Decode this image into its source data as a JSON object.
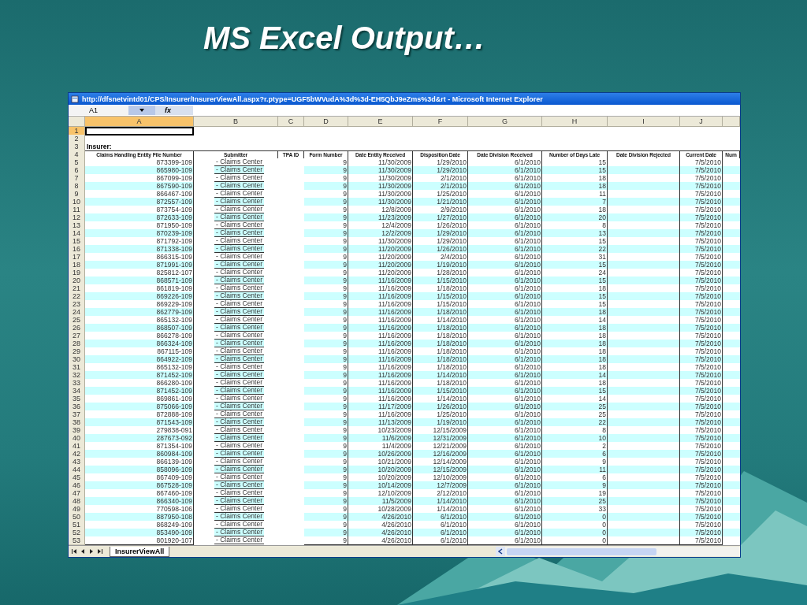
{
  "slide_title": "MS Excel Output…",
  "window": {
    "title": "http://dfsnetvintd01/CPS/Insurer/InsurerViewAll.aspx?r.ptype=UGF5bWVudA%3d%3d-EH5QbJ9eZms%3d&rt - Microsoft Internet Explorer"
  },
  "sheet": {
    "name_box": "A1",
    "function_label": "fx",
    "columns": [
      {
        "label": "A",
        "selected": true
      },
      {
        "label": "B",
        "selected": false
      },
      {
        "label": "C",
        "selected": false
      },
      {
        "label": "D",
        "selected": false
      },
      {
        "label": "E",
        "selected": false
      },
      {
        "label": "F",
        "selected": false
      },
      {
        "label": "G",
        "selected": false
      },
      {
        "label": "H",
        "selected": false
      },
      {
        "label": "I",
        "selected": false
      },
      {
        "label": "J",
        "selected": false
      }
    ],
    "rows": [
      {
        "number": "1",
        "selected": true,
        "kind": "blank"
      },
      {
        "number": "2",
        "selected": false,
        "kind": "blank"
      },
      {
        "number": "3",
        "selected": false,
        "kind": "title",
        "text": "Insurer:"
      },
      {
        "number": "4",
        "selected": false,
        "kind": "header",
        "cells": {
          "a": "Claims Handling Entity File Number",
          "b": "Submitter",
          "c": "TPA ID",
          "d": "Form Number",
          "e": "Date Entity Received",
          "f": "Disposition Date",
          "g": "Date Division Received",
          "h": "Number of Days Late",
          "i": "Date Division Rejected",
          "j": "Current Date",
          "k": "Num"
        }
      },
      {
        "number": "5",
        "selected": false,
        "kind": "data",
        "cells": {
          "a": "873399-109",
          "b": "- Claims Center",
          "d": "9",
          "e": "11/30/2009",
          "f": "1/29/2010",
          "g": "6/1/2010",
          "h": "15",
          "j": "7/5/2010"
        }
      },
      {
        "number": "6",
        "selected": false,
        "kind": "data",
        "cells": {
          "a": "865980-109",
          "b": "- Claims Center",
          "d": "9",
          "e": "11/30/2009",
          "f": "1/29/2010",
          "g": "6/1/2010",
          "h": "15",
          "j": "7/5/2010"
        }
      },
      {
        "number": "7",
        "selected": false,
        "kind": "data",
        "cells": {
          "a": "867099-109",
          "b": "- Claims Center",
          "d": "9",
          "e": "11/30/2009",
          "f": "2/1/2010",
          "g": "6/1/2010",
          "h": "18",
          "j": "7/5/2010"
        }
      },
      {
        "number": "8",
        "selected": false,
        "kind": "data",
        "cells": {
          "a": "867590-109",
          "b": "- Claims Center",
          "d": "9",
          "e": "11/30/2009",
          "f": "2/1/2010",
          "g": "6/1/2010",
          "h": "18",
          "j": "7/5/2010"
        }
      },
      {
        "number": "9",
        "selected": false,
        "kind": "data",
        "cells": {
          "a": "866467-109",
          "b": "- Claims Center",
          "d": "9",
          "e": "11/30/2009",
          "f": "1/25/2010",
          "g": "6/1/2010",
          "h": "11",
          "j": "7/5/2010"
        }
      },
      {
        "number": "10",
        "selected": false,
        "kind": "data",
        "cells": {
          "a": "872557-109",
          "b": "- Claims Center",
          "d": "9",
          "e": "11/30/2009",
          "f": "1/21/2010",
          "g": "6/1/2010",
          "h": "7",
          "j": "7/5/2010"
        }
      },
      {
        "number": "11",
        "selected": false,
        "kind": "data",
        "cells": {
          "a": "873754-109",
          "b": "- Claims Center",
          "d": "9",
          "e": "12/8/2009",
          "f": "2/9/2010",
          "g": "6/1/2010",
          "h": "18",
          "j": "7/5/2010"
        }
      },
      {
        "number": "12",
        "selected": false,
        "kind": "data",
        "cells": {
          "a": "872633-109",
          "b": "- Claims Center",
          "d": "9",
          "e": "11/23/2009",
          "f": "1/27/2010",
          "g": "6/1/2010",
          "h": "20",
          "j": "7/5/2010"
        }
      },
      {
        "number": "13",
        "selected": false,
        "kind": "data",
        "cells": {
          "a": "871950-109",
          "b": "- Claims Center",
          "d": "9",
          "e": "12/4/2009",
          "f": "1/26/2010",
          "g": "6/1/2010",
          "h": "8",
          "j": "7/5/2010"
        }
      },
      {
        "number": "14",
        "selected": false,
        "kind": "data",
        "cells": {
          "a": "870239-109",
          "b": "- Claims Center",
          "d": "9",
          "e": "12/2/2009",
          "f": "1/29/2010",
          "g": "6/1/2010",
          "h": "13",
          "j": "7/5/2010"
        }
      },
      {
        "number": "15",
        "selected": false,
        "kind": "data",
        "cells": {
          "a": "871792-109",
          "b": "- Claims Center",
          "d": "9",
          "e": "11/30/2009",
          "f": "1/29/2010",
          "g": "6/1/2010",
          "h": "15",
          "j": "7/5/2010"
        }
      },
      {
        "number": "16",
        "selected": false,
        "kind": "data",
        "cells": {
          "a": "871338-109",
          "b": "- Claims Center",
          "d": "9",
          "e": "11/20/2009",
          "f": "1/26/2010",
          "g": "6/1/2010",
          "h": "22",
          "j": "7/5/2010"
        }
      },
      {
        "number": "17",
        "selected": false,
        "kind": "data",
        "cells": {
          "a": "866315-109",
          "b": "- Claims Center",
          "d": "9",
          "e": "11/20/2009",
          "f": "2/4/2010",
          "g": "6/1/2010",
          "h": "31",
          "j": "7/5/2010"
        }
      },
      {
        "number": "18",
        "selected": false,
        "kind": "data",
        "cells": {
          "a": "871991-109",
          "b": "- Claims Center",
          "d": "9",
          "e": "11/20/2009",
          "f": "1/19/2010",
          "g": "6/1/2010",
          "h": "15",
          "j": "7/5/2010"
        }
      },
      {
        "number": "19",
        "selected": false,
        "kind": "data",
        "cells": {
          "a": "825812-107",
          "b": "- Claims Center",
          "d": "9",
          "e": "11/20/2009",
          "f": "1/28/2010",
          "g": "6/1/2010",
          "h": "24",
          "j": "7/5/2010"
        }
      },
      {
        "number": "20",
        "selected": false,
        "kind": "data",
        "cells": {
          "a": "868571-109",
          "b": "- Claims Center",
          "d": "9",
          "e": "11/16/2009",
          "f": "1/15/2010",
          "g": "6/1/2010",
          "h": "15",
          "j": "7/5/2010"
        }
      },
      {
        "number": "21",
        "selected": false,
        "kind": "data",
        "cells": {
          "a": "861819-109",
          "b": "- Claims Center",
          "d": "9",
          "e": "11/16/2009",
          "f": "1/18/2010",
          "g": "6/1/2010",
          "h": "18",
          "j": "7/5/2010"
        }
      },
      {
        "number": "22",
        "selected": false,
        "kind": "data",
        "cells": {
          "a": "869226-109",
          "b": "- Claims Center",
          "d": "9",
          "e": "11/16/2009",
          "f": "1/15/2010",
          "g": "6/1/2010",
          "h": "15",
          "j": "7/5/2010"
        }
      },
      {
        "number": "23",
        "selected": false,
        "kind": "data",
        "cells": {
          "a": "869229-109",
          "b": "- Claims Center",
          "d": "9",
          "e": "11/16/2009",
          "f": "1/15/2010",
          "g": "6/1/2010",
          "h": "15",
          "j": "7/5/2010"
        }
      },
      {
        "number": "24",
        "selected": false,
        "kind": "data",
        "cells": {
          "a": "862779-109",
          "b": "- Claims Center",
          "d": "9",
          "e": "11/16/2009",
          "f": "1/18/2010",
          "g": "6/1/2010",
          "h": "18",
          "j": "7/5/2010"
        }
      },
      {
        "number": "25",
        "selected": false,
        "kind": "data",
        "cells": {
          "a": "865132-109",
          "b": "- Claims Center",
          "d": "9",
          "e": "11/16/2009",
          "f": "1/14/2010",
          "g": "6/1/2010",
          "h": "14",
          "j": "7/5/2010"
        }
      },
      {
        "number": "26",
        "selected": false,
        "kind": "data",
        "cells": {
          "a": "868507-109",
          "b": "- Claims Center",
          "d": "9",
          "e": "11/16/2009",
          "f": "1/18/2010",
          "g": "6/1/2010",
          "h": "18",
          "j": "7/5/2010"
        }
      },
      {
        "number": "27",
        "selected": false,
        "kind": "data",
        "cells": {
          "a": "866278-109",
          "b": "- Claims Center",
          "d": "9",
          "e": "11/16/2009",
          "f": "1/18/2010",
          "g": "6/1/2010",
          "h": "18",
          "j": "7/5/2010"
        }
      },
      {
        "number": "28",
        "selected": false,
        "kind": "data",
        "cells": {
          "a": "866324-109",
          "b": "- Claims Center",
          "d": "9",
          "e": "11/16/2009",
          "f": "1/18/2010",
          "g": "6/1/2010",
          "h": "18",
          "j": "7/5/2010"
        }
      },
      {
        "number": "29",
        "selected": false,
        "kind": "data",
        "cells": {
          "a": "867115-109",
          "b": "- Claims Center",
          "d": "9",
          "e": "11/16/2009",
          "f": "1/18/2010",
          "g": "6/1/2010",
          "h": "18",
          "j": "7/5/2010"
        }
      },
      {
        "number": "30",
        "selected": false,
        "kind": "data",
        "cells": {
          "a": "864922-109",
          "b": "- Claims Center",
          "d": "9",
          "e": "11/16/2009",
          "f": "1/18/2010",
          "g": "6/1/2010",
          "h": "18",
          "j": "7/5/2010"
        }
      },
      {
        "number": "31",
        "selected": false,
        "kind": "data",
        "cells": {
          "a": "865132-109",
          "b": "- Claims Center",
          "d": "9",
          "e": "11/16/2009",
          "f": "1/18/2010",
          "g": "6/1/2010",
          "h": "18",
          "j": "7/5/2010"
        }
      },
      {
        "number": "32",
        "selected": false,
        "kind": "data",
        "cells": {
          "a": "871452-109",
          "b": "- Claims Center",
          "d": "9",
          "e": "11/16/2009",
          "f": "1/14/2010",
          "g": "6/1/2010",
          "h": "14",
          "j": "7/5/2010"
        }
      },
      {
        "number": "33",
        "selected": false,
        "kind": "data",
        "cells": {
          "a": "866280-109",
          "b": "- Claims Center",
          "d": "9",
          "e": "11/16/2009",
          "f": "1/18/2010",
          "g": "6/1/2010",
          "h": "18",
          "j": "7/5/2010"
        }
      },
      {
        "number": "34",
        "selected": false,
        "kind": "data",
        "cells": {
          "a": "871452-109",
          "b": "- Claims Center",
          "d": "9",
          "e": "11/16/2009",
          "f": "1/15/2010",
          "g": "6/1/2010",
          "h": "15",
          "j": "7/5/2010"
        }
      },
      {
        "number": "35",
        "selected": false,
        "kind": "data",
        "cells": {
          "a": "869861-109",
          "b": "- Claims Center",
          "d": "9",
          "e": "11/16/2009",
          "f": "1/14/2010",
          "g": "6/1/2010",
          "h": "14",
          "j": "7/5/2010"
        }
      },
      {
        "number": "36",
        "selected": false,
        "kind": "data",
        "cells": {
          "a": "875066-109",
          "b": "- Claims Center",
          "d": "9",
          "e": "11/17/2009",
          "f": "1/26/2010",
          "g": "6/1/2010",
          "h": "25",
          "j": "7/5/2010"
        }
      },
      {
        "number": "37",
        "selected": false,
        "kind": "data",
        "cells": {
          "a": "872888-109",
          "b": "- Claims Center",
          "d": "9",
          "e": "11/16/2009",
          "f": "1/25/2010",
          "g": "6/1/2010",
          "h": "25",
          "j": "7/5/2010"
        }
      },
      {
        "number": "38",
        "selected": false,
        "kind": "data",
        "cells": {
          "a": "871543-109",
          "b": "- Claims Center",
          "d": "9",
          "e": "11/13/2009",
          "f": "1/19/2010",
          "g": "6/1/2010",
          "h": "22",
          "j": "7/5/2010"
        }
      },
      {
        "number": "39",
        "selected": false,
        "kind": "data",
        "cells": {
          "a": "279838-091",
          "b": "- Claims Center",
          "d": "9",
          "e": "10/23/2009",
          "f": "12/15/2009",
          "g": "6/1/2010",
          "h": "8",
          "j": "7/5/2010"
        }
      },
      {
        "number": "40",
        "selected": false,
        "kind": "data",
        "cells": {
          "a": "287673-092",
          "b": "- Claims Center",
          "d": "9",
          "e": "11/6/2009",
          "f": "12/31/2009",
          "g": "6/1/2010",
          "h": "10",
          "j": "7/5/2010"
        }
      },
      {
        "number": "41",
        "selected": false,
        "kind": "data",
        "cells": {
          "a": "871354-109",
          "b": "- Claims Center",
          "d": "9",
          "e": "11/4/2009",
          "f": "12/21/2009",
          "g": "6/1/2010",
          "h": "2",
          "j": "7/5/2010"
        }
      },
      {
        "number": "42",
        "selected": false,
        "kind": "data",
        "cells": {
          "a": "860984-109",
          "b": "- Claims Center",
          "d": "9",
          "e": "10/26/2009",
          "f": "12/16/2009",
          "g": "6/1/2010",
          "h": "6",
          "j": "7/5/2010"
        }
      },
      {
        "number": "43",
        "selected": false,
        "kind": "data",
        "cells": {
          "a": "866139-109",
          "b": "- Claims Center",
          "d": "9",
          "e": "10/21/2009",
          "f": "12/14/2009",
          "g": "6/1/2010",
          "h": "9",
          "j": "7/5/2010"
        }
      },
      {
        "number": "44",
        "selected": false,
        "kind": "data",
        "cells": {
          "a": "858096-109",
          "b": "- Claims Center",
          "d": "9",
          "e": "10/20/2009",
          "f": "12/15/2009",
          "g": "6/1/2010",
          "h": "11",
          "j": "7/5/2010"
        }
      },
      {
        "number": "45",
        "selected": false,
        "kind": "data",
        "cells": {
          "a": "867409-109",
          "b": "- Claims Center",
          "d": "9",
          "e": "10/20/2009",
          "f": "12/10/2009",
          "g": "6/1/2010",
          "h": "6",
          "j": "7/5/2010"
        }
      },
      {
        "number": "46",
        "selected": false,
        "kind": "data",
        "cells": {
          "a": "867528-109",
          "b": "- Claims Center",
          "d": "9",
          "e": "10/14/2009",
          "f": "12/7/2009",
          "g": "6/1/2010",
          "h": "9",
          "j": "7/5/2010"
        }
      },
      {
        "number": "47",
        "selected": false,
        "kind": "data",
        "cells": {
          "a": "867460-109",
          "b": "- Claims Center",
          "d": "9",
          "e": "12/10/2009",
          "f": "2/12/2010",
          "g": "6/1/2010",
          "h": "19",
          "j": "7/5/2010"
        }
      },
      {
        "number": "48",
        "selected": false,
        "kind": "data",
        "cells": {
          "a": "866340-109",
          "b": "- Claims Center",
          "d": "9",
          "e": "11/5/2009",
          "f": "1/14/2010",
          "g": "6/1/2010",
          "h": "25",
          "j": "7/5/2010"
        }
      },
      {
        "number": "49",
        "selected": false,
        "kind": "data",
        "cells": {
          "a": "770598-106",
          "b": "- Claims Center",
          "d": "9",
          "e": "10/28/2009",
          "f": "1/14/2010",
          "g": "6/1/2010",
          "h": "33",
          "j": "7/5/2010"
        }
      },
      {
        "number": "50",
        "selected": false,
        "kind": "data",
        "cells": {
          "a": "887950-108",
          "b": "- Claims Center",
          "d": "9",
          "e": "4/26/2010",
          "f": "6/1/2010",
          "g": "6/1/2010",
          "h": "0",
          "j": "7/5/2010"
        }
      },
      {
        "number": "51",
        "selected": false,
        "kind": "data",
        "cells": {
          "a": "868249-109",
          "b": "- Claims Center",
          "d": "9",
          "e": "4/26/2010",
          "f": "6/1/2010",
          "g": "6/1/2010",
          "h": "0",
          "j": "7/5/2010"
        }
      },
      {
        "number": "52",
        "selected": false,
        "kind": "data",
        "cells": {
          "a": "853490-109",
          "b": "- Claims Center",
          "d": "9",
          "e": "4/26/2010",
          "f": "6/1/2010",
          "g": "6/1/2010",
          "h": "0",
          "j": "7/5/2010"
        }
      },
      {
        "number": "53",
        "selected": false,
        "kind": "data",
        "cells": {
          "a": "801920-107",
          "b": "- Claims Center",
          "d": "9",
          "e": "4/26/2010",
          "f": "6/1/2010",
          "g": "6/1/2010",
          "h": "0",
          "j": "7/5/2010"
        }
      }
    ]
  },
  "sheet_tabs": [
    {
      "label": "InsurerViewAll",
      "selected": true
    }
  ]
}
